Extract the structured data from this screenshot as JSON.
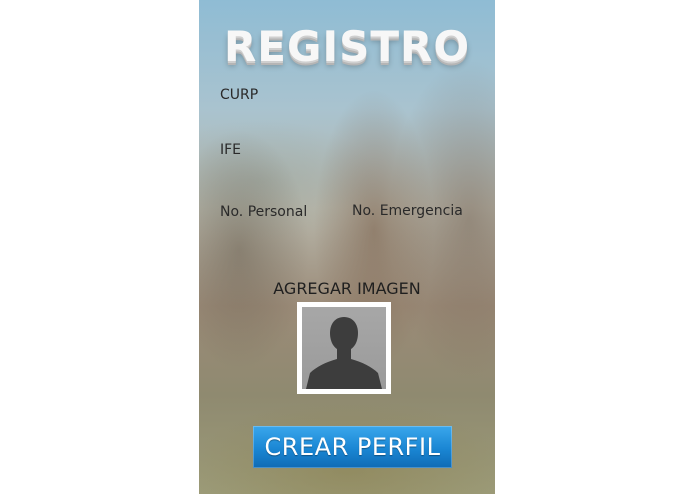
{
  "screen": {
    "title": "REGISTRO",
    "fields": {
      "curp_label": "CURP",
      "ife_label": "IFE",
      "personal_phone_label": "No. Personal",
      "emergency_phone_label": "No. Emergencia"
    },
    "image_section": {
      "label": "AGREGAR IMAGEN",
      "placeholder_icon": "default-user-silhouette-icon"
    },
    "primary_button": {
      "label": "CREAR PERFIL",
      "color": "#1a86d3"
    }
  }
}
